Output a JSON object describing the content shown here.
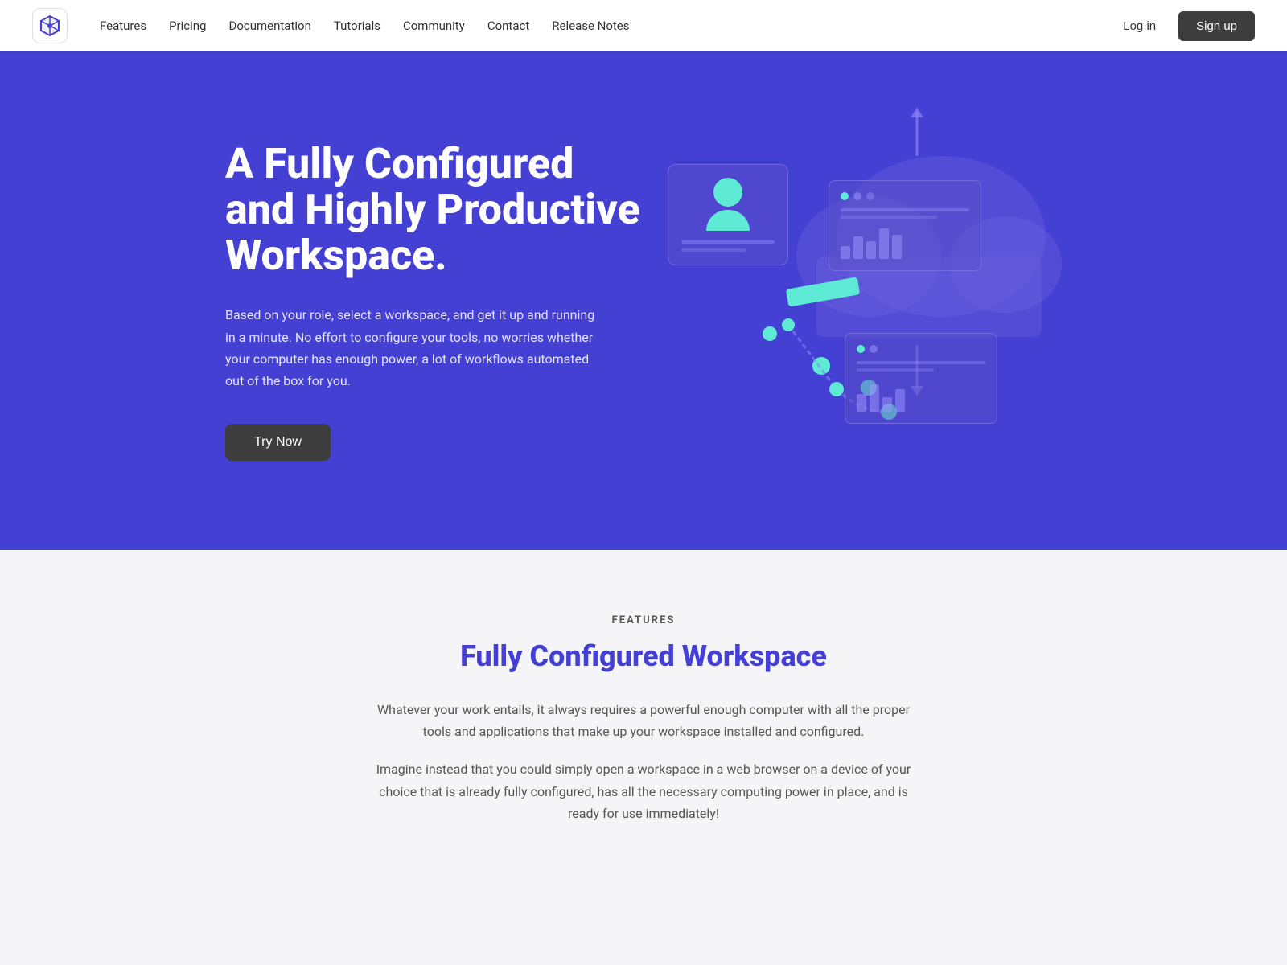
{
  "navbar": {
    "logo_alt": "App Logo",
    "links": [
      {
        "label": "Features",
        "id": "features"
      },
      {
        "label": "Pricing",
        "id": "pricing"
      },
      {
        "label": "Documentation",
        "id": "documentation"
      },
      {
        "label": "Tutorials",
        "id": "tutorials"
      },
      {
        "label": "Community",
        "id": "community"
      },
      {
        "label": "Contact",
        "id": "contact"
      },
      {
        "label": "Release Notes",
        "id": "release-notes"
      }
    ],
    "login_label": "Log in",
    "signup_label": "Sign up"
  },
  "hero": {
    "title": "A Fully Configured and Highly Productive Workspace.",
    "description": "Based on your role, select a workspace, and get it up and running in a minute. No effort to configure your tools, no worries whether your computer has enough power, a lot of workflows automated out of the box for you.",
    "cta_label": "Try Now",
    "bg_color": "#4540d4"
  },
  "features_section": {
    "label": "FEATURES",
    "title": "Fully Configured Workspace",
    "desc1": "Whatever your work entails, it always requires a powerful enough computer with all the proper tools and applications that make up your workspace installed and configured.",
    "desc2": "Imagine instead that you could simply open a workspace in a web browser on a device of your choice that is already fully configured, has all the necessary computing power in place, and is ready for use immediately!"
  }
}
